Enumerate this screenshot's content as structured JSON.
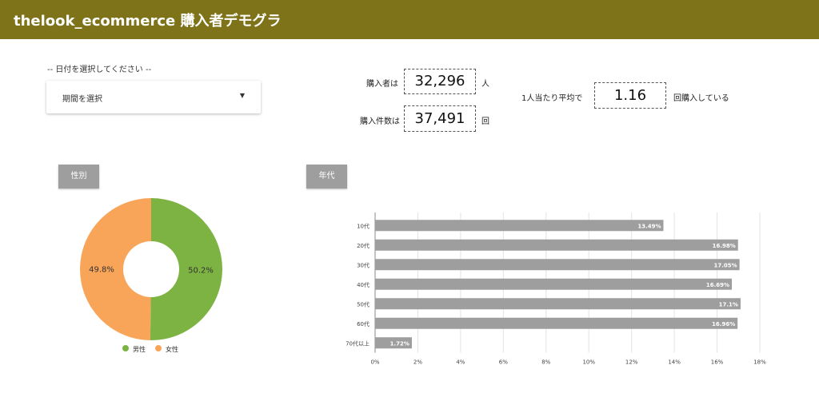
{
  "header": {
    "title": "thelook_ecommerce 購入者デモグラ"
  },
  "date_filter": {
    "label": "-- 日付を選択してください --",
    "value": "期間を選択",
    "caret": "▼"
  },
  "kpis": {
    "buyers_label": "購入者は",
    "buyers_value": "32,296",
    "buyers_unit": "人",
    "orders_label": "購入件数は",
    "orders_value": "37,491",
    "orders_unit": "回",
    "avg_label": "1人当たり平均で",
    "avg_value": "1.16",
    "avg_unit": "回購入している"
  },
  "sections": {
    "gender": "性別",
    "age": "年代"
  },
  "colors": {
    "header": "#7f731a",
    "male": "#7cb342",
    "female": "#f8a55a",
    "bar": "#9e9e9e"
  },
  "chart_data": [
    {
      "type": "pie",
      "hole": true,
      "labels": [
        "男性",
        "女性"
      ],
      "values": [
        50.2,
        49.8
      ],
      "value_labels": [
        "50.2%",
        "49.8%"
      ],
      "legend": "bottom"
    },
    {
      "type": "bar",
      "orientation": "horizontal",
      "categories": [
        "10代",
        "20代",
        "30代",
        "40代",
        "50代",
        "60代",
        "70代以上"
      ],
      "values": [
        13.49,
        16.98,
        17.05,
        16.69,
        17.1,
        16.96,
        1.72
      ],
      "value_labels": [
        "13.49%",
        "16.98%",
        "17.05%",
        "16.69%",
        "17.1%",
        "16.96%",
        "1.72%"
      ],
      "xlim": [
        0,
        18
      ],
      "xticks": [
        "0%",
        "2%",
        "4%",
        "6%",
        "8%",
        "10%",
        "12%",
        "14%",
        "16%",
        "18%"
      ],
      "grid": true
    }
  ]
}
